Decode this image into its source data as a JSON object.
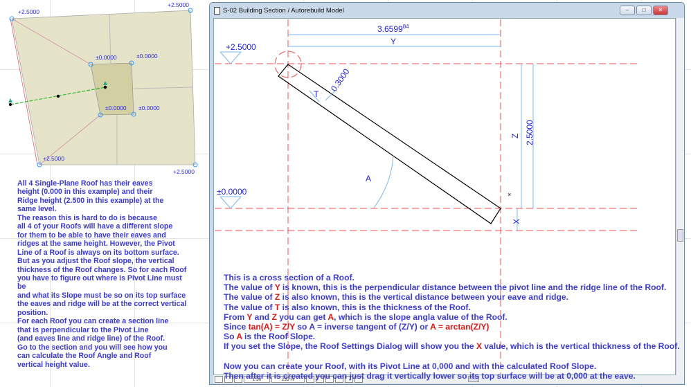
{
  "plan": {
    "levels": {
      "tl": "+2.5000",
      "tr": "+2.5000",
      "bl": "+2.5000",
      "br": "+2.5000",
      "i1": "±0.0000",
      "i2": "±0.0000",
      "i3": "±0.0000",
      "i4": "±0.0000"
    }
  },
  "left_text": [
    "All 4 Single-Plane Roof has their eaves",
    "height (0.000 in this example) and their",
    "Ridge height (2.500 in this example) at the",
    "same level.",
    "The reason this is hard to do is because",
    "all 4 of your Roofs will have a different slope",
    "for them to be able to have their eaves and",
    "ridges at the same height. However, the Pivot",
    "Line of a Roof is always on its bottom surface.",
    "But as you adjust the Roof slope, the vertical",
    "thickness of the Roof changes. So for each Roof",
    "you have to figure out where is Pivot Line must",
    "be",
    "and what its Slope must be so on its top surface",
    "the eaves and ridge will be at the correct vertical",
    "position.",
    "For each Roof you can create a section line",
    "that is perpendicular to the Pivot Line",
    "(and eaves line and ridge line) of the Roof.",
    "Go to the section and you will see how you",
    "can calculate the Roof Angle and Roof",
    "vertical height value."
  ],
  "window": {
    "title": "S-02 Building Section / Autorebuild Model",
    "minimize": "–",
    "maximize": "□",
    "close": "✕"
  },
  "section": {
    "dim_length": "3.6599",
    "dim_length_sup": "84",
    "label_y": "Y",
    "level_top": "+2.5000",
    "level_bottom": "±0.0000",
    "label_t": "T",
    "thickness": "0.3000",
    "label_z": "Z",
    "height": "2.5000",
    "label_x": "X",
    "label_a": "A"
  },
  "section_text": [
    [
      {
        "t": "This is a cross section of a Roof."
      }
    ],
    [
      {
        "t": "The value of "
      },
      {
        "t": "Y",
        "h": 1
      },
      {
        "t": " is known, this is the perpendicular distance between the pivot line and the ridge line of the Roof."
      }
    ],
    [
      {
        "t": "The value of "
      },
      {
        "t": "Z",
        "h": 1
      },
      {
        "t": " is also known, this is the vertical distance between your eave and ridge."
      }
    ],
    [
      {
        "t": "The value of "
      },
      {
        "t": "T",
        "h": 1
      },
      {
        "t": " is also known, this is the thickness of the Roof."
      }
    ],
    [
      {
        "t": "From "
      },
      {
        "t": "Y",
        "h": 1
      },
      {
        "t": " and "
      },
      {
        "t": "Z",
        "h": 1
      },
      {
        "t": " you can get "
      },
      {
        "t": "A",
        "h": 1
      },
      {
        "t": ", which is the slope angla value of the Roof."
      }
    ],
    [
      {
        "t": "Since "
      },
      {
        "t": "tan(A) = Z/Y",
        "h": 1
      },
      {
        "t": " so A = inverse tangent of (Z/Y) or "
      },
      {
        "t": "A = arctan(Z/Y)",
        "h": 1
      }
    ],
    [
      {
        "t": "So "
      },
      {
        "t": "A",
        "h": 1
      },
      {
        "t": " is the Roof Slope."
      }
    ],
    [
      {
        "t": "If you set the Slope, the Roof Settings Dialog will show you the "
      },
      {
        "t": "X",
        "h": 1
      },
      {
        "t": " value, which is the vertical thickness of the Roof."
      }
    ],
    [
      {
        "t": " "
      }
    ],
    [
      {
        "t": "Now you can create your Roof, with its Pivot Line at 0,000 and with the calculated Roof Slope."
      }
    ],
    [
      {
        "t": "Then after it is created you can just drag it vertically lower so its top surface will be at 0,000 at the eave."
      }
    ]
  ],
  "statusbar": {
    "scale": "1:50",
    "zoom": "235 %"
  }
}
